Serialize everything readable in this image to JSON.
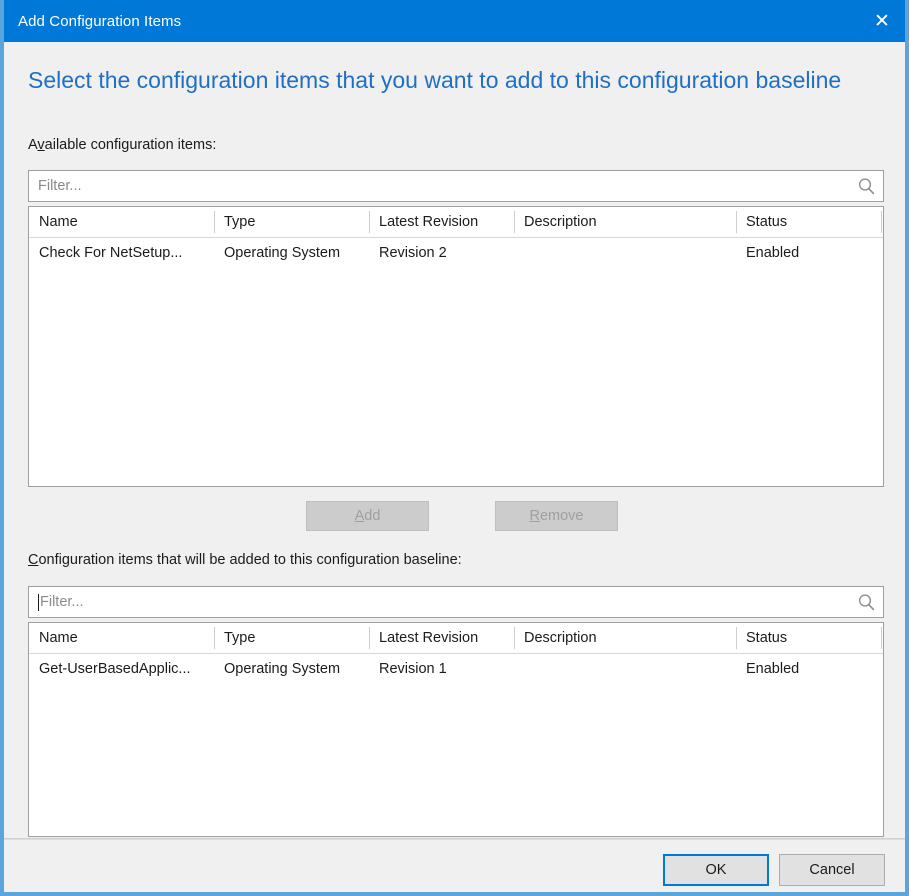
{
  "window": {
    "title": "Add Configuration Items",
    "close_icon": "close-icon",
    "accent_color": "#0078d7",
    "border_color": "#5aa5dc",
    "body_color": "#f0f0f0"
  },
  "heading": "Select the configuration items that you want to add to this configuration baseline",
  "available": {
    "label_prefix": "A",
    "label_accel": "v",
    "label_suffix": "ailable configuration items:",
    "filter": {
      "value": "",
      "placeholder": "Filter...",
      "icon": "search-icon",
      "focused": false
    },
    "columns": [
      "Name",
      "Type",
      "Latest Revision",
      "Description",
      "Status"
    ],
    "rows": [
      {
        "name": "Check For NetSetup...",
        "type": "Operating System",
        "latest_revision": "Revision 2",
        "description": "",
        "status": "Enabled"
      }
    ]
  },
  "transfer_buttons": {
    "add": {
      "label_accel": "A",
      "label_rest": "dd",
      "disabled": true
    },
    "remove": {
      "label_accel": "R",
      "label_rest": "emove",
      "disabled": true
    }
  },
  "selected": {
    "label_accel": "C",
    "label_suffix": "onfiguration items that will be added to this configuration baseline:",
    "filter": {
      "value": "",
      "placeholder": "Filter...",
      "icon": "search-icon",
      "focused": true
    },
    "columns": [
      "Name",
      "Type",
      "Latest Revision",
      "Description",
      "Status"
    ],
    "rows": [
      {
        "name": "Get-UserBasedApplic...",
        "type": "Operating System",
        "latest_revision": "Revision 1",
        "description": "",
        "status": "Enabled"
      }
    ]
  },
  "footer": {
    "ok_label": "OK",
    "cancel_label": "Cancel"
  }
}
